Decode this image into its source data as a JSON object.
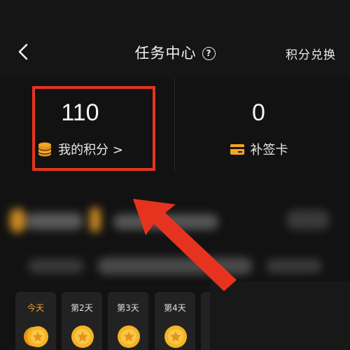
{
  "header": {
    "title": "任务中心",
    "help_symbol": "?",
    "exchange_label": "积分兑换"
  },
  "stats": {
    "points": {
      "value": "110",
      "label": "我的积分 >"
    },
    "makeup_card": {
      "value": "0",
      "label": "补签卡"
    }
  },
  "days": [
    {
      "label": "今天",
      "today": true
    },
    {
      "label": "第2天",
      "today": false
    },
    {
      "label": "第3天",
      "today": false
    },
    {
      "label": "第4天",
      "today": false
    }
  ],
  "colors": {
    "accent": "#f6a623",
    "highlight": "#e5331f",
    "background": "#141414"
  }
}
